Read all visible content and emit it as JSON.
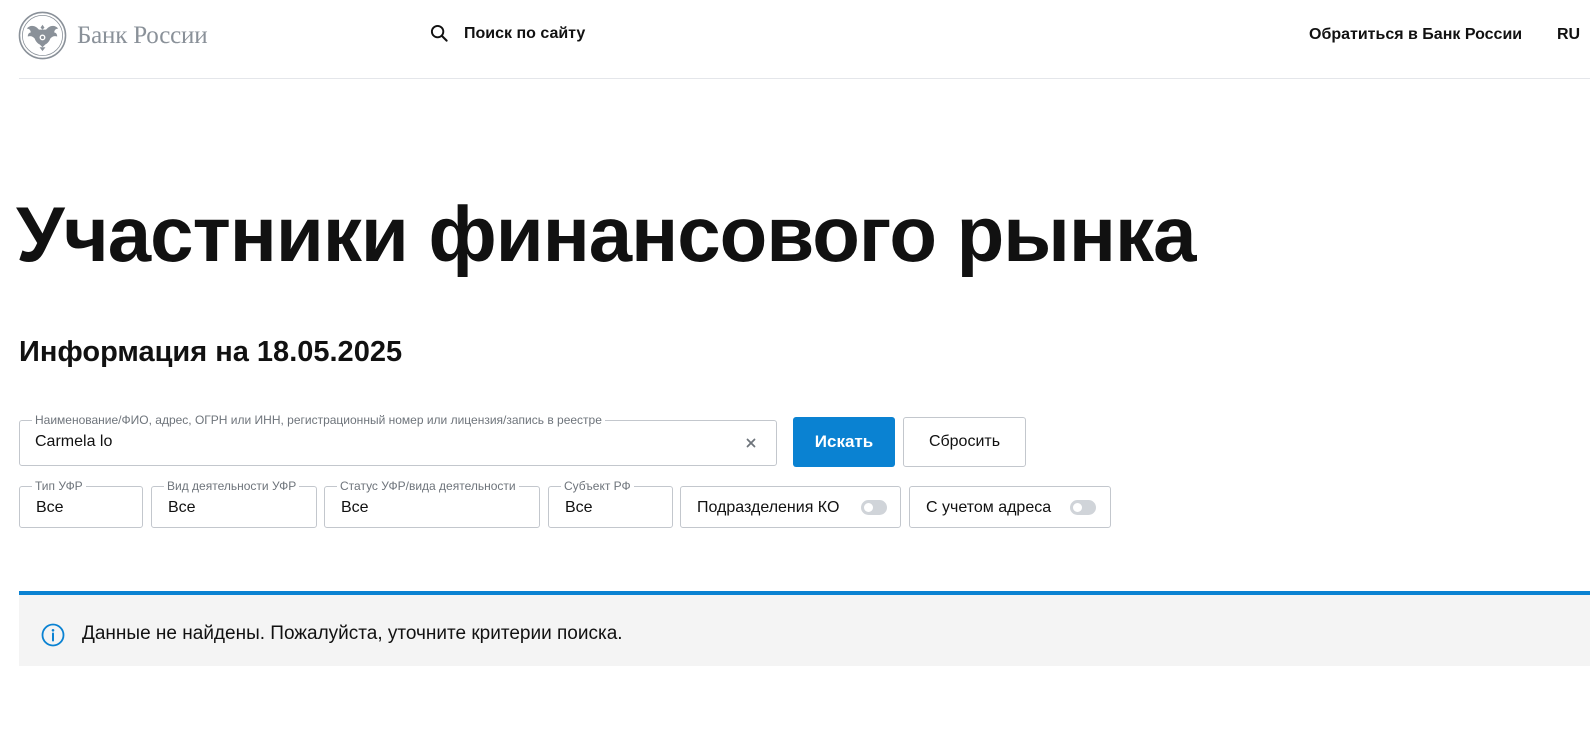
{
  "header": {
    "logo_text": "Банк России",
    "search_label": "Поиск по сайту",
    "contact_label": "Обратиться в Банк России",
    "lang_label": "RU"
  },
  "main": {
    "title": "Участники финансового рынка",
    "info_date": "Информация на 18.05.2025"
  },
  "search": {
    "field_label": "Наименование/ФИО, адрес, ОГРН или ИНН, регистрационный номер или лицензия/запись в реестре",
    "value": "Carmela lo",
    "submit_label": "Искать",
    "reset_label": "Сбросить"
  },
  "filters": {
    "ufr_type": {
      "label": "Тип УФР",
      "value": "Все"
    },
    "activity_type": {
      "label": "Вид деятельности УФР",
      "value": "Все"
    },
    "status": {
      "label": "Статус УФР/вида деятельности",
      "value": "Все"
    },
    "region": {
      "label": "Субъект РФ",
      "value": "Все"
    },
    "ko_branches": {
      "label": "Подразделения КО",
      "enabled": false
    },
    "with_address": {
      "label": "С учетом адреса",
      "enabled": false
    }
  },
  "alert": {
    "message": "Данные не найдены. Пожалуйста, уточните критерии поиска.",
    "icon": "info-icon"
  },
  "colors": {
    "accent": "#0a82d2",
    "text": "#111111",
    "logo_gray": "#8a9199",
    "alert_bg": "#f4f4f4",
    "border": "#c3c7cd"
  }
}
